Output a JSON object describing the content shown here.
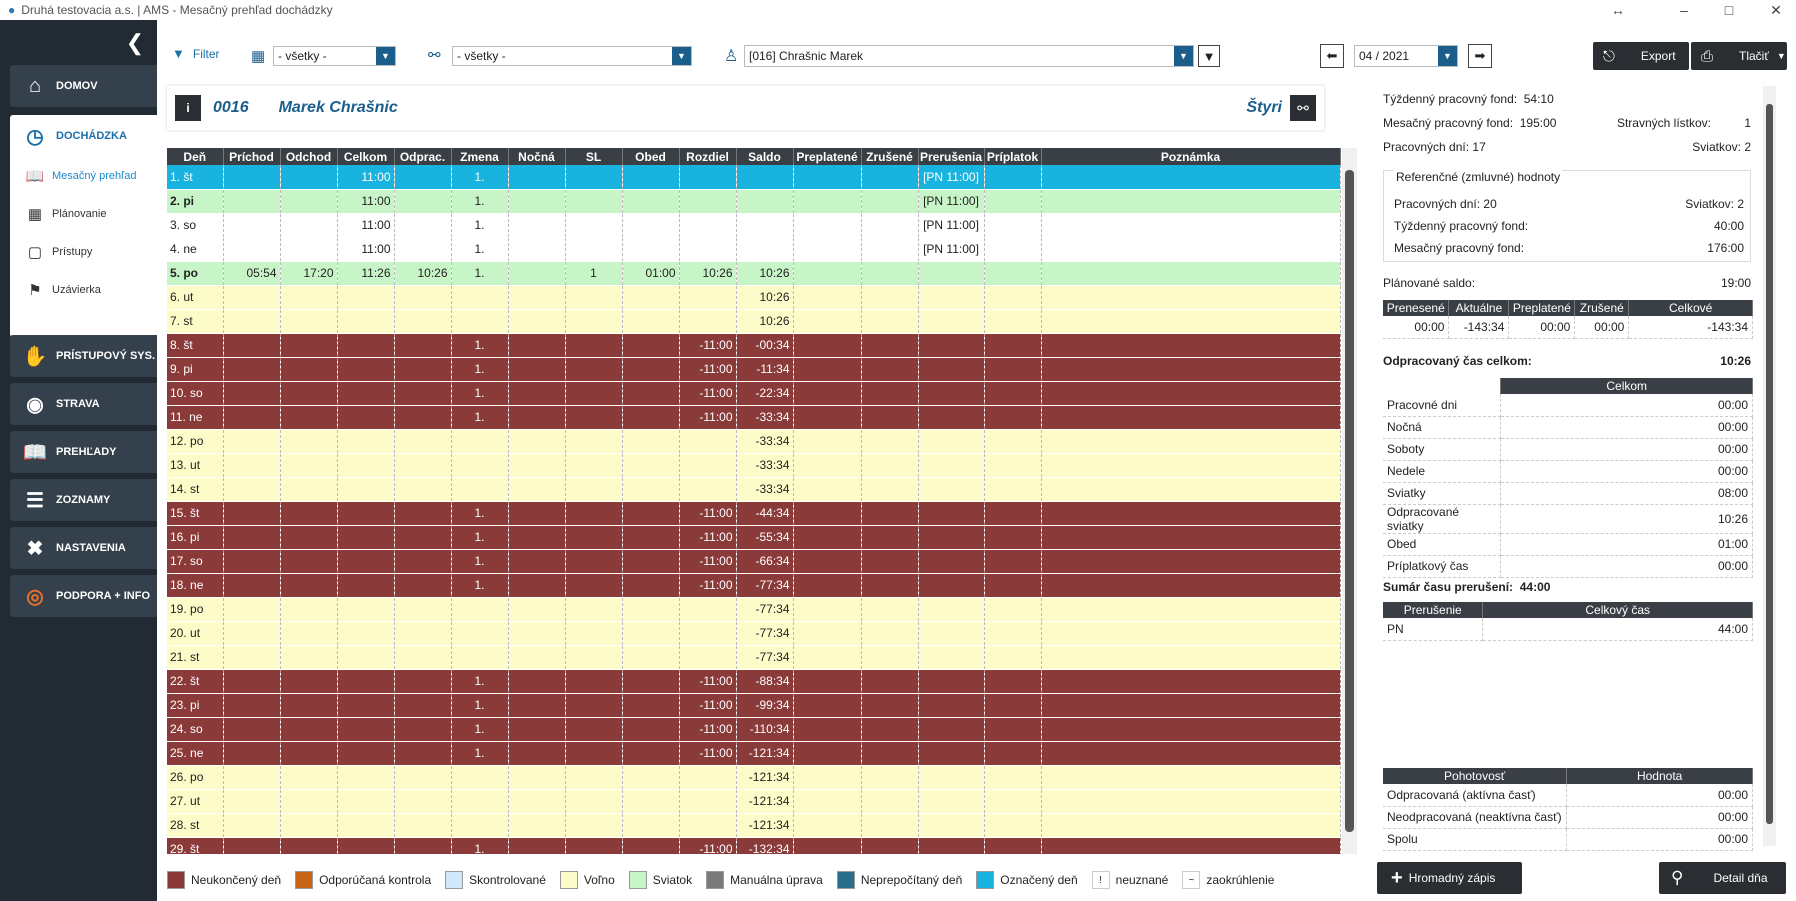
{
  "window": {
    "title": "Druhá testovacia a.s. | AMS - Mesačný prehľad dochádzky"
  },
  "nav": {
    "domov": "DOMOV",
    "dochadzka": "DOCHÁDZKA",
    "sub": [
      "Mesačný prehľad",
      "Plánovanie",
      "Prístupy",
      "Uzávierka"
    ],
    "items": [
      "PRÍSTUPOVÝ SYS.",
      "STRAVA",
      "PREHĽADY",
      "ZOZNAMY",
      "NASTAVENIA",
      "PODPORA + INFO"
    ]
  },
  "toolbar": {
    "filter": "Filter",
    "dept": "- všetky -",
    "group": "- všetky -",
    "employee": "[016] Chrašnic Marek",
    "period": "04 / 2021",
    "export": "Export",
    "print": "Tlačiť"
  },
  "employee": {
    "number": "0016",
    "name": "Marek Chrašnic",
    "shift": "Štyri"
  },
  "grid": {
    "headers": [
      "Deň",
      "Príchod",
      "Odchod",
      "Celkom",
      "Odprac.",
      "Zmena",
      "Nočná",
      "SL",
      "Obed",
      "Rozdiel",
      "Saldo",
      "Preplatené",
      "Zrušené",
      "Prerušenia",
      "Príplatok",
      "Poznámka"
    ],
    "rows": [
      [
        "1. št",
        "",
        "",
        "11:00",
        "",
        "1.",
        "",
        "",
        "",
        "",
        "",
        "",
        "",
        "[PN 11:00]",
        "",
        ""
      ],
      [
        "2. pi",
        "",
        "",
        "11:00",
        "",
        "1.",
        "",
        "",
        "",
        "",
        "",
        "",
        "",
        "[PN 11:00]",
        "",
        ""
      ],
      [
        "3. so",
        "",
        "",
        "11:00",
        "",
        "1.",
        "",
        "",
        "",
        "",
        "",
        "",
        "",
        "[PN 11:00]",
        "",
        ""
      ],
      [
        "4. ne",
        "",
        "",
        "11:00",
        "",
        "1.",
        "",
        "",
        "",
        "",
        "",
        "",
        "",
        "[PN 11:00]",
        "",
        ""
      ],
      [
        "5. po",
        "05:54",
        "17:20",
        "11:26",
        "10:26",
        "1.",
        "",
        "1",
        "01:00",
        "10:26",
        "10:26",
        "",
        "",
        "",
        "",
        ""
      ],
      [
        "6. ut",
        "",
        "",
        "",
        "",
        "",
        "",
        "",
        "",
        "",
        "10:26",
        "",
        "",
        "",
        "",
        ""
      ],
      [
        "7. st",
        "",
        "",
        "",
        "",
        "",
        "",
        "",
        "",
        "",
        "10:26",
        "",
        "",
        "",
        "",
        ""
      ],
      [
        "8. št",
        "",
        "",
        "",
        "",
        "1.",
        "",
        "",
        "",
        "-11:00",
        "-00:34",
        "",
        "",
        "",
        "",
        ""
      ],
      [
        "9. pi",
        "",
        "",
        "",
        "",
        "1.",
        "",
        "",
        "",
        "-11:00",
        "-11:34",
        "",
        "",
        "",
        "",
        ""
      ],
      [
        "10. so",
        "",
        "",
        "",
        "",
        "1.",
        "",
        "",
        "",
        "-11:00",
        "-22:34",
        "",
        "",
        "",
        "",
        ""
      ],
      [
        "11. ne",
        "",
        "",
        "",
        "",
        "1.",
        "",
        "",
        "",
        "-11:00",
        "-33:34",
        "",
        "",
        "",
        "",
        ""
      ],
      [
        "12. po",
        "",
        "",
        "",
        "",
        "",
        "",
        "",
        "",
        "",
        "-33:34",
        "",
        "",
        "",
        "",
        ""
      ],
      [
        "13. ut",
        "",
        "",
        "",
        "",
        "",
        "",
        "",
        "",
        "",
        "-33:34",
        "",
        "",
        "",
        "",
        ""
      ],
      [
        "14. st",
        "",
        "",
        "",
        "",
        "",
        "",
        "",
        "",
        "",
        "-33:34",
        "",
        "",
        "",
        "",
        ""
      ],
      [
        "15. št",
        "",
        "",
        "",
        "",
        "1.",
        "",
        "",
        "",
        "-11:00",
        "-44:34",
        "",
        "",
        "",
        "",
        ""
      ],
      [
        "16. pi",
        "",
        "",
        "",
        "",
        "1.",
        "",
        "",
        "",
        "-11:00",
        "-55:34",
        "",
        "",
        "",
        "",
        ""
      ],
      [
        "17. so",
        "",
        "",
        "",
        "",
        "1.",
        "",
        "",
        "",
        "-11:00",
        "-66:34",
        "",
        "",
        "",
        "",
        ""
      ],
      [
        "18. ne",
        "",
        "",
        "",
        "",
        "1.",
        "",
        "",
        "",
        "-11:00",
        "-77:34",
        "",
        "",
        "",
        "",
        ""
      ],
      [
        "19. po",
        "",
        "",
        "",
        "",
        "",
        "",
        "",
        "",
        "",
        "-77:34",
        "",
        "",
        "",
        "",
        ""
      ],
      [
        "20. ut",
        "",
        "",
        "",
        "",
        "",
        "",
        "",
        "",
        "",
        "-77:34",
        "",
        "",
        "",
        "",
        ""
      ],
      [
        "21. st",
        "",
        "",
        "",
        "",
        "",
        "",
        "",
        "",
        "",
        "-77:34",
        "",
        "",
        "",
        "",
        ""
      ],
      [
        "22. št",
        "",
        "",
        "",
        "",
        "1.",
        "",
        "",
        "",
        "-11:00",
        "-88:34",
        "",
        "",
        "",
        "",
        ""
      ],
      [
        "23. pi",
        "",
        "",
        "",
        "",
        "1.",
        "",
        "",
        "",
        "-11:00",
        "-99:34",
        "",
        "",
        "",
        "",
        ""
      ],
      [
        "24. so",
        "",
        "",
        "",
        "",
        "1.",
        "",
        "",
        "",
        "-11:00",
        "-110:34",
        "",
        "",
        "",
        "",
        ""
      ],
      [
        "25. ne",
        "",
        "",
        "",
        "",
        "1.",
        "",
        "",
        "",
        "-11:00",
        "-121:34",
        "",
        "",
        "",
        "",
        ""
      ],
      [
        "26. po",
        "",
        "",
        "",
        "",
        "",
        "",
        "",
        "",
        "",
        "-121:34",
        "",
        "",
        "",
        "",
        ""
      ],
      [
        "27. ut",
        "",
        "",
        "",
        "",
        "",
        "",
        "",
        "",
        "",
        "-121:34",
        "",
        "",
        "",
        "",
        ""
      ],
      [
        "28. st",
        "",
        "",
        "",
        "",
        "",
        "",
        "",
        "",
        "",
        "-121:34",
        "",
        "",
        "",
        "",
        ""
      ],
      [
        "29. št",
        "",
        "",
        "",
        "",
        "1.",
        "",
        "",
        "",
        "-11:00",
        "-132:34",
        "",
        "",
        "",
        "",
        ""
      ]
    ],
    "row_styles": [
      "today",
      "holiday",
      "white",
      "white",
      "holiday",
      "free",
      "free",
      "uncl",
      "uncl",
      "uncl",
      "uncl",
      "free",
      "free",
      "free",
      "uncl",
      "uncl",
      "uncl",
      "uncl",
      "free",
      "free",
      "free",
      "uncl",
      "uncl",
      "uncl",
      "uncl",
      "free",
      "free",
      "free",
      "uncl"
    ]
  },
  "legend": [
    {
      "label": "Neukončený deň",
      "color": "#8b3a3a"
    },
    {
      "label": "Odporúčaná kontrola",
      "color": "#c8641a"
    },
    {
      "label": "Skontrolované",
      "color": "#cfe8fb"
    },
    {
      "label": "Voľno",
      "color": "#fdfbc8"
    },
    {
      "label": "Sviatok",
      "color": "#c8f5c8"
    },
    {
      "label": "Manuálna úprava",
      "color": "#7a7a7a"
    },
    {
      "label": "Neprepočítaný deň",
      "color": "#2a6e8e"
    },
    {
      "label": "Označený deň",
      "color": "#19b3df"
    }
  ],
  "legend_extra": [
    {
      "sym": "!",
      "label": "neuznané"
    },
    {
      "sym": "~",
      "label": "zaokrúhlenie"
    }
  ],
  "summary": {
    "weekly_fund_label": "Týždenný pracovný fond:",
    "weekly_fund": "54:10",
    "monthly_fund_label": "Mesačný pracovný fond:",
    "monthly_fund": "195:00",
    "meal_label": "Stravných lístkov:",
    "meal": "1",
    "workdays_label": "Pracovných dní:",
    "workdays": "17",
    "holidays_label": "Sviatkov:",
    "holidays": "2",
    "ref_title": "Referenčné (zmluvné) hodnoty",
    "ref_workdays_label": "Pracovných dní:",
    "ref_workdays": "20",
    "ref_holidays_label": "Sviatkov:",
    "ref_holidays": "2",
    "ref_weekly_label": "Týždenný pracovný fond:",
    "ref_weekly": "40:00",
    "ref_monthly_label": "Mesačný pracovný fond:",
    "ref_monthly": "176:00",
    "plan_label": "Plánované saldo:",
    "plan": "19:00",
    "saldo_headers": [
      "Prenesené",
      "Aktuálne",
      "Preplatené",
      "Zrušené",
      "Celkové"
    ],
    "saldo_values": [
      "00:00",
      "-143:34",
      "00:00",
      "00:00",
      "-143:34"
    ],
    "worked_label": "Odpracovaný čas celkom:",
    "worked": "10:26",
    "worked_header": "Celkom",
    "worked_rows": [
      [
        "Pracovné dni",
        "00:00"
      ],
      [
        "Nočná",
        "00:00"
      ],
      [
        "Soboty",
        "00:00"
      ],
      [
        "Nedele",
        "00:00"
      ],
      [
        "Sviatky",
        "08:00"
      ],
      [
        "Odpracované sviatky",
        "10:26"
      ],
      [
        "Obed",
        "01:00"
      ],
      [
        "Príplatkový čas",
        "00:00"
      ]
    ],
    "interrupt_label": "Sumár času prerušení:",
    "interrupt": "44:00",
    "interrupt_headers": [
      "Prerušenie",
      "Celkový čas"
    ],
    "interrupt_rows": [
      [
        "PN",
        "44:00"
      ]
    ],
    "standby_headers": [
      "Pohotovosť",
      "Hodnota"
    ],
    "standby_rows": [
      [
        "Odpracovaná (aktívna časť)",
        "00:00"
      ],
      [
        "Neodpracovaná (neaktívna časť)",
        "00:00"
      ],
      [
        "Spolu",
        "00:00"
      ]
    ]
  },
  "buttons": {
    "mass": "Hromadný zápis",
    "detail": "Detail dňa"
  }
}
